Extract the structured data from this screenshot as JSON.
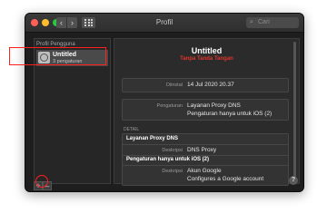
{
  "window": {
    "title": "Profil"
  },
  "toolbar": {
    "back_glyph": "‹",
    "forward_glyph": "›",
    "grid_icon": "grid-icon",
    "search_placeholder": "Cari",
    "search_icon": "search-icon"
  },
  "sidebar": {
    "header": "Profil Pengguna",
    "items": [
      {
        "name": "Untitled",
        "count": "3 pengaturan",
        "icon": "settings-profile-icon"
      }
    ],
    "add_label": "+",
    "remove_label": "–"
  },
  "profile": {
    "title": "Untitled",
    "subtitle": "Tanpa Tanda Tangan",
    "installed_label": "Diinstal",
    "installed_value": "14 Jul 2020 20.37",
    "settings_label": "Pengaturan",
    "settings_values": [
      "Layanan Proxy DNS",
      "Pengaturan hanya untuk iOS (2)"
    ]
  },
  "detail": {
    "header": "DETAIL",
    "sections": [
      {
        "title": "Layanan Proxy DNS",
        "desc_label": "Deskripsi",
        "desc_value": "DNS Proxy"
      },
      {
        "title": "Pengaturan hanya untuk iOS (2)",
        "desc_label": "Deskripsi",
        "desc_value": "Akun Google",
        "desc_value2": "Configures a Google account"
      }
    ]
  },
  "help_label": "?",
  "colors": {
    "accent_highlight": "#ff1f1f",
    "subtitle_red": "#e0352c",
    "window_bg": "#1e1e1e"
  }
}
